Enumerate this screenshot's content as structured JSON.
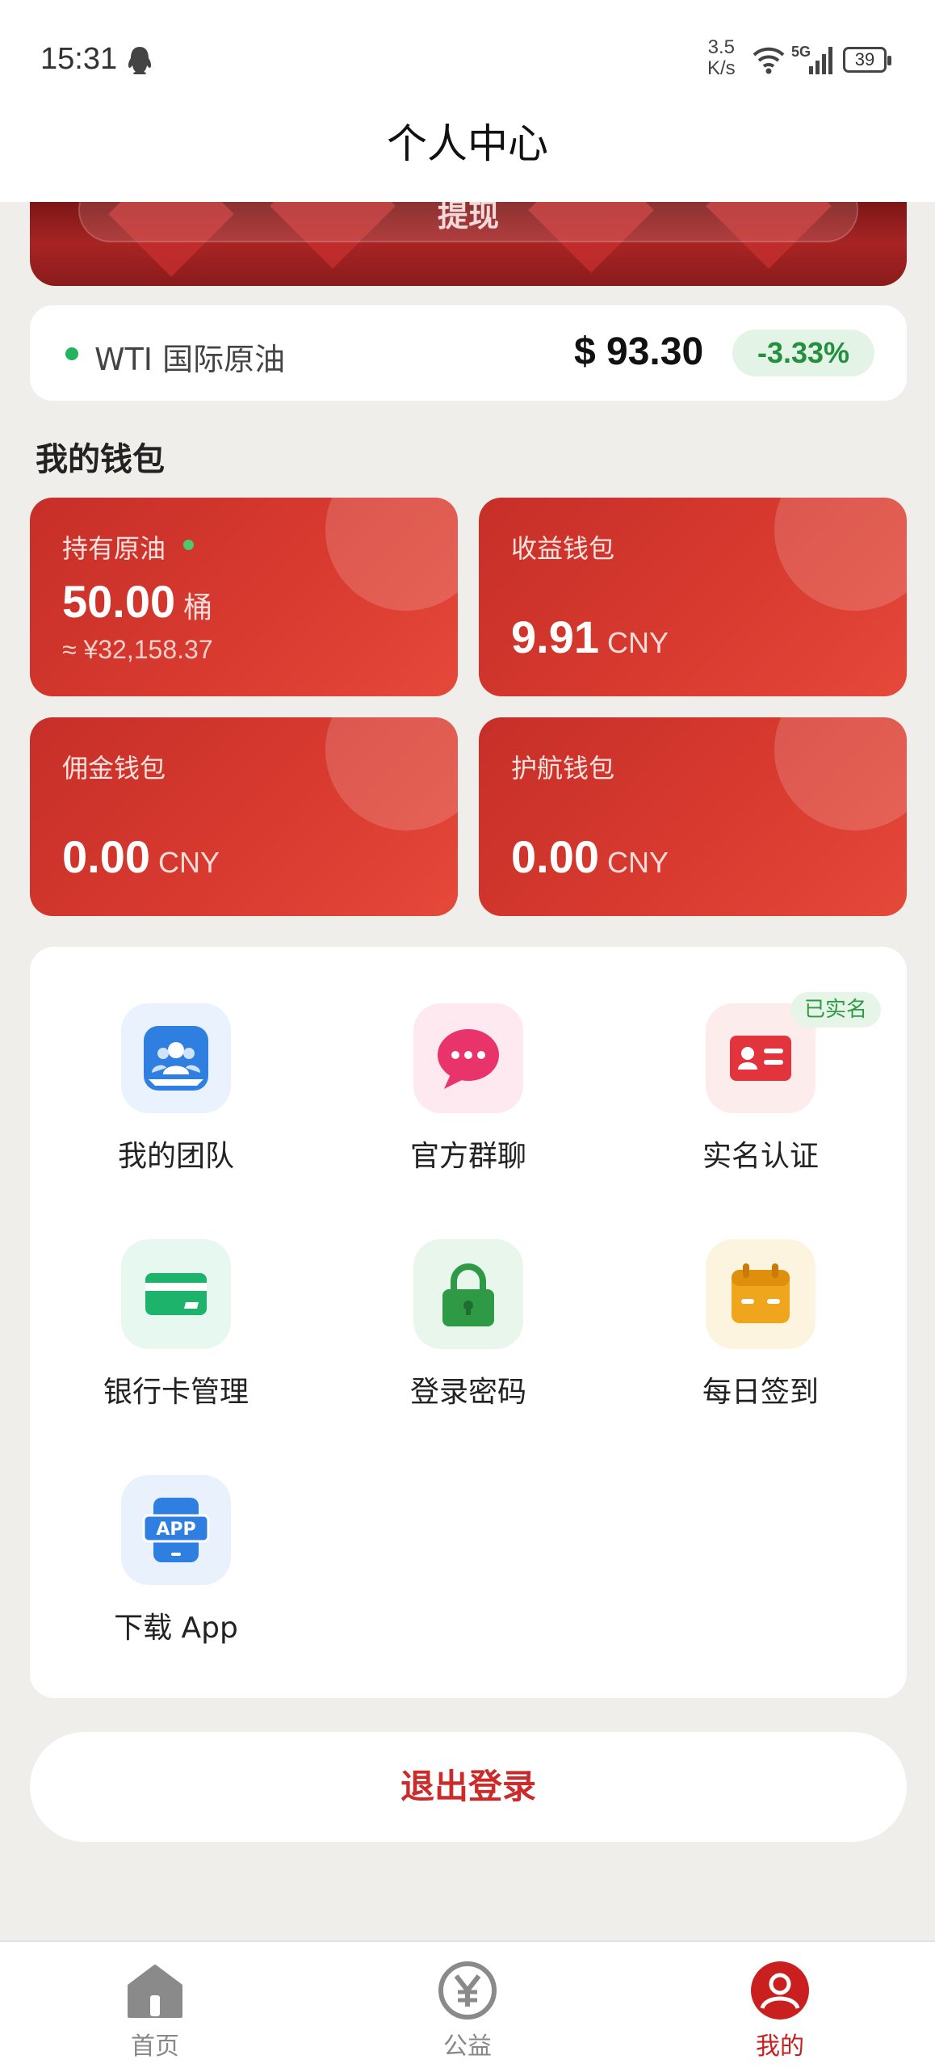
{
  "status_bar": {
    "time": "15:31",
    "speed_value": "3.5",
    "speed_unit": "K/s",
    "network": "5G",
    "battery": "39"
  },
  "header": {
    "title": "个人中心"
  },
  "banner": {
    "button_label": "提现"
  },
  "ticker": {
    "name": "WTI 国际原油",
    "price": "$ 93.30",
    "change": "-3.33%",
    "status_color": "#22b45a"
  },
  "wallet": {
    "section_title": "我的钱包",
    "cards": [
      {
        "label": "持有原油",
        "amount": "50.00",
        "unit": "桶",
        "sub": "≈ ¥32,158.37"
      },
      {
        "label": "收益钱包",
        "amount": "9.91",
        "unit": "CNY"
      },
      {
        "label": "佣金钱包",
        "amount": "0.00",
        "unit": "CNY"
      },
      {
        "label": "护航钱包",
        "amount": "0.00",
        "unit": "CNY"
      }
    ]
  },
  "menu": {
    "items": [
      {
        "label": "我的团队",
        "icon": "team-icon"
      },
      {
        "label": "官方群聊",
        "icon": "chat-icon"
      },
      {
        "label": "实名认证",
        "icon": "id-card-icon",
        "badge": "已实名"
      },
      {
        "label": "银行卡管理",
        "icon": "bank-card-icon"
      },
      {
        "label": "登录密码",
        "icon": "lock-icon"
      },
      {
        "label": "每日签到",
        "icon": "calendar-icon"
      },
      {
        "label": "下载 App",
        "icon": "app-download-icon"
      }
    ]
  },
  "logout": {
    "label": "退出登录"
  },
  "tabbar": {
    "items": [
      {
        "label": "首页",
        "icon": "home-icon"
      },
      {
        "label": "公益",
        "icon": "yuan-icon"
      },
      {
        "label": "我的",
        "icon": "user-icon",
        "active": true
      }
    ]
  },
  "colors": {
    "accent": "#c91f1f",
    "card_red": "#d83a2f",
    "positive_green": "#23903f"
  }
}
